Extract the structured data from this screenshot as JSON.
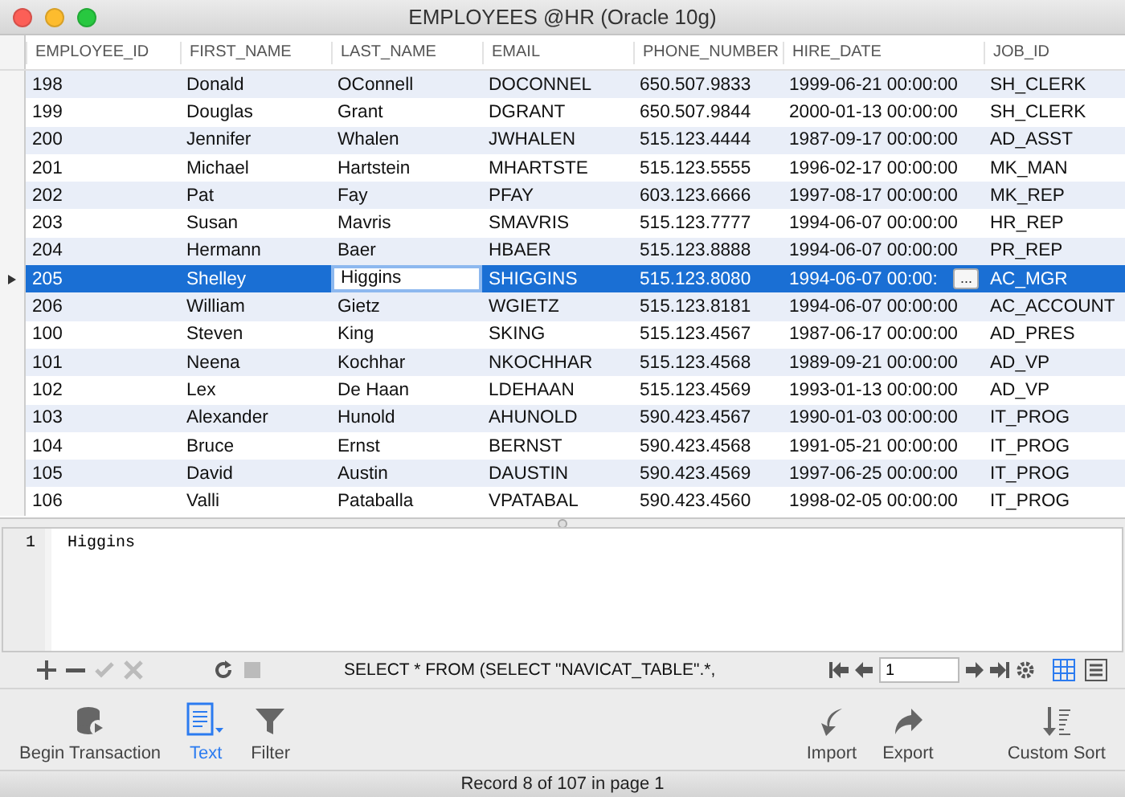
{
  "window": {
    "title": "EMPLOYEES @HR (Oracle 10g)"
  },
  "table": {
    "columns": [
      {
        "label": "EMPLOYEE_ID",
        "editing": false
      },
      {
        "label": "FIRST_NAME",
        "editing": false
      },
      {
        "label": "LAST_NAME",
        "editing": true
      },
      {
        "label": "EMAIL",
        "editing": false
      },
      {
        "label": "PHONE_NUMBER",
        "editing": false
      },
      {
        "label": "HIRE_DATE",
        "editing": false
      },
      {
        "label": "JOB_ID",
        "editing": false
      }
    ],
    "rows": [
      {
        "selected": false,
        "cells": [
          "198",
          "Donald",
          "OConnell",
          "DOCONNEL",
          "650.507.9833",
          "1999-06-21 00:00:00",
          "SH_CLERK"
        ]
      },
      {
        "selected": false,
        "cells": [
          "199",
          "Douglas",
          "Grant",
          "DGRANT",
          "650.507.9844",
          "2000-01-13 00:00:00",
          "SH_CLERK"
        ]
      },
      {
        "selected": false,
        "cells": [
          "200",
          "Jennifer",
          "Whalen",
          "JWHALEN",
          "515.123.4444",
          "1987-09-17 00:00:00",
          "AD_ASST"
        ]
      },
      {
        "selected": false,
        "cells": [
          "201",
          "Michael",
          "Hartstein",
          "MHARTSTE",
          "515.123.5555",
          "1996-02-17 00:00:00",
          "MK_MAN"
        ]
      },
      {
        "selected": false,
        "cells": [
          "202",
          "Pat",
          "Fay",
          "PFAY",
          "603.123.6666",
          "1997-08-17 00:00:00",
          "MK_REP"
        ]
      },
      {
        "selected": false,
        "cells": [
          "203",
          "Susan",
          "Mavris",
          "SMAVRIS",
          "515.123.7777",
          "1994-06-07 00:00:00",
          "HR_REP"
        ]
      },
      {
        "selected": false,
        "cells": [
          "204",
          "Hermann",
          "Baer",
          "HBAER",
          "515.123.8888",
          "1994-06-07 00:00:00",
          "PR_REP"
        ]
      },
      {
        "selected": true,
        "cells": [
          "205",
          "Shelley",
          "Higgins",
          "SHIGGINS",
          "515.123.8080",
          "1994-06-07 00:00:",
          "AC_MGR"
        ],
        "cell_button": "..."
      },
      {
        "selected": false,
        "cells": [
          "206",
          "William",
          "Gietz",
          "WGIETZ",
          "515.123.8181",
          "1994-06-07 00:00:00",
          "AC_ACCOUNT"
        ]
      },
      {
        "selected": false,
        "cells": [
          "100",
          "Steven",
          "King",
          "SKING",
          "515.123.4567",
          "1987-06-17 00:00:00",
          "AD_PRES"
        ]
      },
      {
        "selected": false,
        "cells": [
          "101",
          "Neena",
          "Kochhar",
          "NKOCHHAR",
          "515.123.4568",
          "1989-09-21 00:00:00",
          "AD_VP"
        ]
      },
      {
        "selected": false,
        "cells": [
          "102",
          "Lex",
          "De Haan",
          "LDEHAAN",
          "515.123.4569",
          "1993-01-13 00:00:00",
          "AD_VP"
        ]
      },
      {
        "selected": false,
        "cells": [
          "103",
          "Alexander",
          "Hunold",
          "AHUNOLD",
          "590.423.4567",
          "1990-01-03 00:00:00",
          "IT_PROG"
        ]
      },
      {
        "selected": false,
        "cells": [
          "104",
          "Bruce",
          "Ernst",
          "BERNST",
          "590.423.4568",
          "1991-05-21 00:00:00",
          "IT_PROG"
        ]
      },
      {
        "selected": false,
        "cells": [
          "105",
          "David",
          "Austin",
          "DAUSTIN",
          "590.423.4569",
          "1997-06-25 00:00:00",
          "IT_PROG"
        ]
      },
      {
        "selected": false,
        "cells": [
          "106",
          "Valli",
          "Pataballa",
          "VPATABAL",
          "590.423.4560",
          "1998-02-05 00:00:00",
          "IT_PROG"
        ]
      }
    ]
  },
  "editor": {
    "line_number": "1",
    "text": "Higgins"
  },
  "nav_bar": {
    "actions": [
      {
        "kind": "add",
        "disabled": false
      },
      {
        "kind": "remove",
        "disabled": false
      },
      {
        "kind": "apply",
        "disabled": true
      },
      {
        "kind": "cancel",
        "disabled": true
      },
      {
        "kind": "refresh",
        "disabled": false
      },
      {
        "kind": "stop",
        "disabled": true
      }
    ],
    "sql": "SELECT * FROM (SELECT \"NAVICAT_TABLE\".*,",
    "page": "1",
    "views": [
      {
        "kind": "grid",
        "selected": true
      },
      {
        "kind": "form",
        "selected": false
      }
    ]
  },
  "toolbar": {
    "left": [
      {
        "kind": "transaction",
        "label": "Begin Transaction",
        "selected": false
      },
      {
        "kind": "text",
        "label": "Text",
        "selected": true
      },
      {
        "kind": "filter",
        "label": "Filter",
        "selected": false
      }
    ],
    "right": [
      {
        "kind": "import",
        "label": "Import",
        "selected": false
      },
      {
        "kind": "export",
        "label": "Export",
        "selected": false
      },
      {
        "kind": "sort",
        "label": "Custom Sort",
        "selected": false
      }
    ]
  },
  "status_bar": "Record 8 of 107 in page 1"
}
